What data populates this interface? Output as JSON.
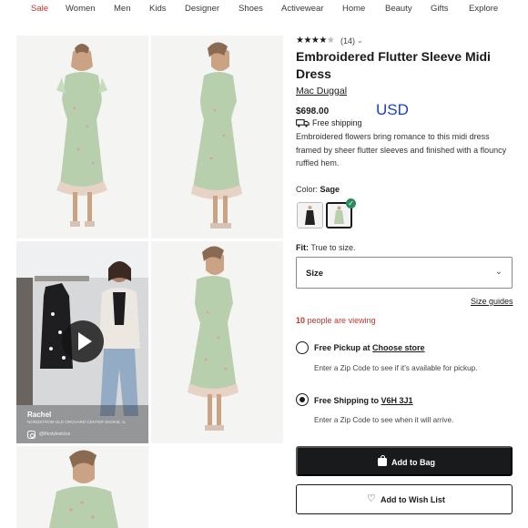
{
  "nav": {
    "items": [
      "Sale",
      "Women",
      "Men",
      "Kids",
      "Designer",
      "Shoes",
      "Activewear",
      "Home",
      "Beauty",
      "Gifts",
      "Explore"
    ],
    "sale_color": "#c2352b"
  },
  "gallery": {
    "video": {
      "name": "Rachel",
      "subtitle": "NORDSTROM OLD ORCHARD CENTER SKOKIE, IL",
      "handle": "@lifestylestclsx",
      "icon": "play-icon"
    }
  },
  "product": {
    "rating": 4,
    "rating_max": 5,
    "review_count": "(14)",
    "title": "Embroidered Flutter Sleeve Midi Dress",
    "brand": "Mac Duggal",
    "price": "$698.00",
    "currency_note": "USD",
    "shipping": "Free shipping",
    "description": "Embroidered flowers bring romance to this midi dress framed by sheer flutter sleeves and finished with a flouncy ruffled hem.",
    "color_label": "Color:",
    "color_value": "Sage",
    "colors": [
      "Black",
      "Sage"
    ],
    "selected_color": "Sage",
    "fit_label": "Fit:",
    "fit_value": "True to size.",
    "size_label": "Size",
    "size_guides": "Size guides",
    "viewing_count": "10",
    "viewing_text": "people are viewing"
  },
  "fulfillment": {
    "pickup": {
      "title": "Free Pickup at",
      "link": "Choose store",
      "help": "Enter a Zip Code to see if it's available for pickup.",
      "selected": false
    },
    "shipping": {
      "title": "Free Shipping to",
      "link": "V6H 3J1",
      "help": "Enter a Zip Code to see when it will arrive.",
      "selected": true
    }
  },
  "actions": {
    "add_to_bag": "Add to Bag",
    "add_to_wishlist": "Add to Wish List"
  },
  "colors": {
    "primary": "#191a1b",
    "accent_red": "#c2352b",
    "check_green": "#2c8a5f",
    "dress_sage": "#b7cfac",
    "currency_blue": "#1f3fbf"
  }
}
